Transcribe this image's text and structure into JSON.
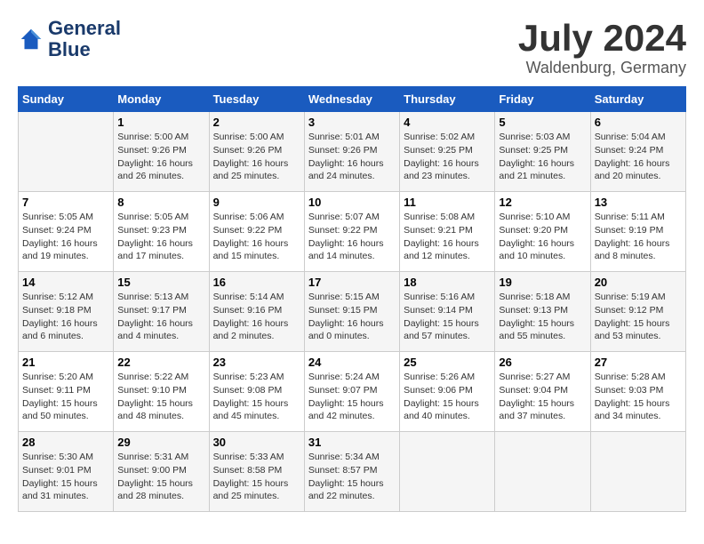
{
  "header": {
    "logo_line1": "General",
    "logo_line2": "Blue",
    "month": "July 2024",
    "location": "Waldenburg, Germany"
  },
  "weekdays": [
    "Sunday",
    "Monday",
    "Tuesday",
    "Wednesday",
    "Thursday",
    "Friday",
    "Saturday"
  ],
  "weeks": [
    [
      {
        "day": "",
        "info": ""
      },
      {
        "day": "1",
        "info": "Sunrise: 5:00 AM\nSunset: 9:26 PM\nDaylight: 16 hours\nand 26 minutes."
      },
      {
        "day": "2",
        "info": "Sunrise: 5:00 AM\nSunset: 9:26 PM\nDaylight: 16 hours\nand 25 minutes."
      },
      {
        "day": "3",
        "info": "Sunrise: 5:01 AM\nSunset: 9:26 PM\nDaylight: 16 hours\nand 24 minutes."
      },
      {
        "day": "4",
        "info": "Sunrise: 5:02 AM\nSunset: 9:25 PM\nDaylight: 16 hours\nand 23 minutes."
      },
      {
        "day": "5",
        "info": "Sunrise: 5:03 AM\nSunset: 9:25 PM\nDaylight: 16 hours\nand 21 minutes."
      },
      {
        "day": "6",
        "info": "Sunrise: 5:04 AM\nSunset: 9:24 PM\nDaylight: 16 hours\nand 20 minutes."
      }
    ],
    [
      {
        "day": "7",
        "info": "Sunrise: 5:05 AM\nSunset: 9:24 PM\nDaylight: 16 hours\nand 19 minutes."
      },
      {
        "day": "8",
        "info": "Sunrise: 5:05 AM\nSunset: 9:23 PM\nDaylight: 16 hours\nand 17 minutes."
      },
      {
        "day": "9",
        "info": "Sunrise: 5:06 AM\nSunset: 9:22 PM\nDaylight: 16 hours\nand 15 minutes."
      },
      {
        "day": "10",
        "info": "Sunrise: 5:07 AM\nSunset: 9:22 PM\nDaylight: 16 hours\nand 14 minutes."
      },
      {
        "day": "11",
        "info": "Sunrise: 5:08 AM\nSunset: 9:21 PM\nDaylight: 16 hours\nand 12 minutes."
      },
      {
        "day": "12",
        "info": "Sunrise: 5:10 AM\nSunset: 9:20 PM\nDaylight: 16 hours\nand 10 minutes."
      },
      {
        "day": "13",
        "info": "Sunrise: 5:11 AM\nSunset: 9:19 PM\nDaylight: 16 hours\nand 8 minutes."
      }
    ],
    [
      {
        "day": "14",
        "info": "Sunrise: 5:12 AM\nSunset: 9:18 PM\nDaylight: 16 hours\nand 6 minutes."
      },
      {
        "day": "15",
        "info": "Sunrise: 5:13 AM\nSunset: 9:17 PM\nDaylight: 16 hours\nand 4 minutes."
      },
      {
        "day": "16",
        "info": "Sunrise: 5:14 AM\nSunset: 9:16 PM\nDaylight: 16 hours\nand 2 minutes."
      },
      {
        "day": "17",
        "info": "Sunrise: 5:15 AM\nSunset: 9:15 PM\nDaylight: 16 hours\nand 0 minutes."
      },
      {
        "day": "18",
        "info": "Sunrise: 5:16 AM\nSunset: 9:14 PM\nDaylight: 15 hours\nand 57 minutes."
      },
      {
        "day": "19",
        "info": "Sunrise: 5:18 AM\nSunset: 9:13 PM\nDaylight: 15 hours\nand 55 minutes."
      },
      {
        "day": "20",
        "info": "Sunrise: 5:19 AM\nSunset: 9:12 PM\nDaylight: 15 hours\nand 53 minutes."
      }
    ],
    [
      {
        "day": "21",
        "info": "Sunrise: 5:20 AM\nSunset: 9:11 PM\nDaylight: 15 hours\nand 50 minutes."
      },
      {
        "day": "22",
        "info": "Sunrise: 5:22 AM\nSunset: 9:10 PM\nDaylight: 15 hours\nand 48 minutes."
      },
      {
        "day": "23",
        "info": "Sunrise: 5:23 AM\nSunset: 9:08 PM\nDaylight: 15 hours\nand 45 minutes."
      },
      {
        "day": "24",
        "info": "Sunrise: 5:24 AM\nSunset: 9:07 PM\nDaylight: 15 hours\nand 42 minutes."
      },
      {
        "day": "25",
        "info": "Sunrise: 5:26 AM\nSunset: 9:06 PM\nDaylight: 15 hours\nand 40 minutes."
      },
      {
        "day": "26",
        "info": "Sunrise: 5:27 AM\nSunset: 9:04 PM\nDaylight: 15 hours\nand 37 minutes."
      },
      {
        "day": "27",
        "info": "Sunrise: 5:28 AM\nSunset: 9:03 PM\nDaylight: 15 hours\nand 34 minutes."
      }
    ],
    [
      {
        "day": "28",
        "info": "Sunrise: 5:30 AM\nSunset: 9:01 PM\nDaylight: 15 hours\nand 31 minutes."
      },
      {
        "day": "29",
        "info": "Sunrise: 5:31 AM\nSunset: 9:00 PM\nDaylight: 15 hours\nand 28 minutes."
      },
      {
        "day": "30",
        "info": "Sunrise: 5:33 AM\nSunset: 8:58 PM\nDaylight: 15 hours\nand 25 minutes."
      },
      {
        "day": "31",
        "info": "Sunrise: 5:34 AM\nSunset: 8:57 PM\nDaylight: 15 hours\nand 22 minutes."
      },
      {
        "day": "",
        "info": ""
      },
      {
        "day": "",
        "info": ""
      },
      {
        "day": "",
        "info": ""
      }
    ]
  ]
}
